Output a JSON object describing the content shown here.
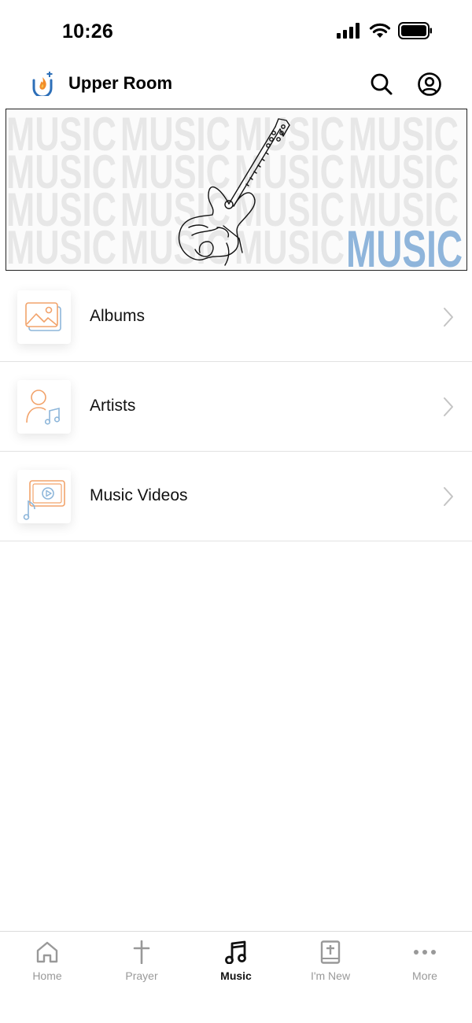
{
  "status_bar": {
    "time": "10:26"
  },
  "header": {
    "title": "Upper Room"
  },
  "banner": {
    "watermark_text": "MUSIC",
    "title": "MUSIC"
  },
  "menu": {
    "items": [
      {
        "label": "Albums",
        "icon": "albums-icon"
      },
      {
        "label": "Artists",
        "icon": "artists-icon"
      },
      {
        "label": "Music Videos",
        "icon": "music-videos-icon"
      }
    ]
  },
  "tab_bar": {
    "tabs": [
      {
        "label": "Home",
        "icon": "home-icon",
        "active": false
      },
      {
        "label": "Prayer",
        "icon": "cross-icon",
        "active": false
      },
      {
        "label": "Music",
        "icon": "music-note-icon",
        "active": true
      },
      {
        "label": "I'm New",
        "icon": "bible-icon",
        "active": false
      },
      {
        "label": "More",
        "icon": "more-icon",
        "active": false
      }
    ]
  },
  "colors": {
    "accent_orange": "#F2A36B",
    "accent_blue": "#8DB6DA",
    "banner_title": "#8FB5DB",
    "inactive_tab": "#999999"
  }
}
